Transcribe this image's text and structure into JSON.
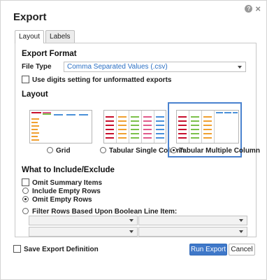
{
  "dialog": {
    "title": "Export"
  },
  "tabs": [
    {
      "label": "Layout",
      "active": true
    },
    {
      "label": "Labels",
      "active": false
    }
  ],
  "export_format": {
    "heading": "Export Format",
    "file_type_label": "File Type",
    "file_type_value": "Comma Separated Values (.csv)",
    "digits_checkbox_label": "Use digits setting for unformatted exports",
    "digits_checked": false
  },
  "layout": {
    "heading": "Layout",
    "options": [
      {
        "label": "Grid",
        "selected": false
      },
      {
        "label": "Tabular Single Column",
        "selected": false
      },
      {
        "label": "Tabular Multiple Column",
        "selected": true
      }
    ]
  },
  "include_exclude": {
    "heading": "What to Include/Exclude",
    "omit_summary_label": "Omit Summary Items",
    "omit_summary_checked": false,
    "include_empty_label": "Include Empty Rows",
    "omit_empty_label": "Omit Empty Rows",
    "empty_rows_selection": "Omit Empty Rows",
    "filter_label": "Filter Rows Based Upon Boolean Line Item:",
    "filter_selected": false
  },
  "footer": {
    "save_definition_label": "Save Export Definition",
    "save_definition_checked": false,
    "run_export_label": "Run Export",
    "cancel_label": "Cancel"
  },
  "colors": {
    "accent": "#3f78c9",
    "selected_border": "#4a82cf",
    "thumb_red": "#c8102e",
    "thumb_orange": "#f0a030",
    "thumb_green": "#7cc04a",
    "thumb_blue": "#4a90d9",
    "thumb_pink": "#e05a8a"
  }
}
